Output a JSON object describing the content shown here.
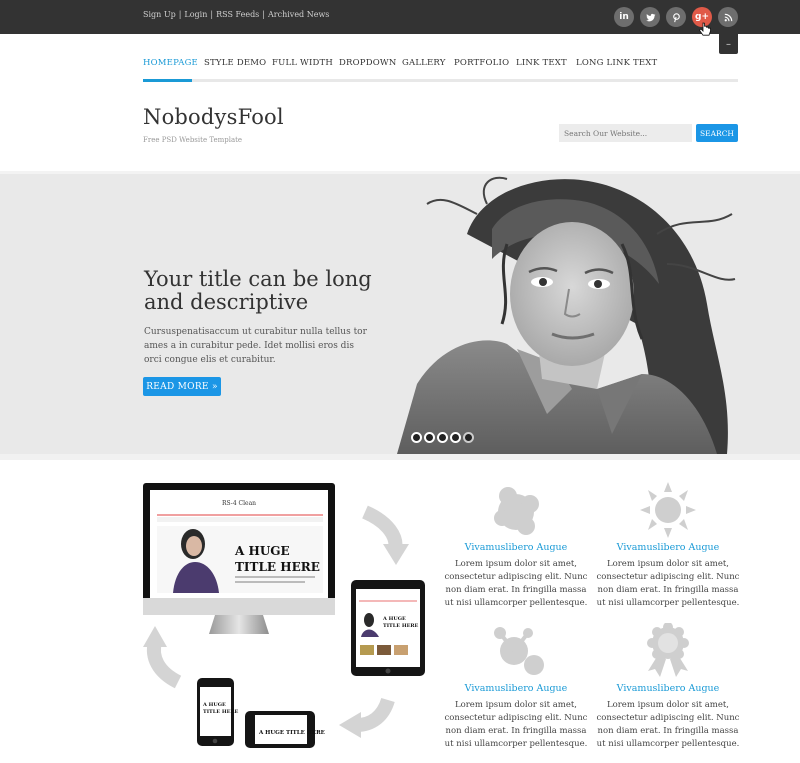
{
  "topbar": {
    "links": [
      "Sign Up",
      "Login",
      "RSS Feeds",
      "Archived News"
    ],
    "separator": "|",
    "social": [
      {
        "icon": "linkedin-icon",
        "glyph": "in"
      },
      {
        "icon": "twitter-icon",
        "glyph": "t"
      },
      {
        "icon": "pinterest-icon",
        "glyph": "p"
      },
      {
        "icon": "google-plus-icon",
        "glyph": "g+"
      },
      {
        "icon": "rss-icon",
        "glyph": "rss"
      }
    ],
    "toggle_label": "–"
  },
  "nav": {
    "items": [
      "HOMEPAGE",
      "STYLE DEMO",
      "FULL WIDTH",
      "DROPDOWN",
      "GALLERY",
      "PORTFOLIO",
      "LINK TEXT",
      "LONG LINK TEXT"
    ],
    "active_index": 0
  },
  "header": {
    "site_name": "NobodysFool",
    "tagline": "Free PSD Website Template",
    "search_placeholder": "Search Our Website...",
    "search_button": "SEARCH"
  },
  "slider": {
    "title": "Your title can be long and descriptive",
    "text": "Cursuspenatisaccum ut curabitur nulla tellus tor ames a in curabitur pede. Idet mollisi eros dis orci congue elis et curabitur.",
    "button": "READ MORE »",
    "dots_total": 5,
    "active_dot": 4
  },
  "devices_mockup": {
    "screen_brand": "RS-4 Clean",
    "screen_headline": "A HUGE TITLE HERE"
  },
  "features": [
    {
      "icon": "puzzle-blob-icon",
      "title": "Vivamuslibero Augue",
      "text": "Lorem ipsum dolor sit amet, consectetur adipiscing elit. Nunc non diam erat. In fringilla massa ut nisi ullamcorper pellentesque."
    },
    {
      "icon": "sun-icon",
      "title": "Vivamuslibero Augue",
      "text": "Lorem ipsum dolor sit amet, consectetur adipiscing elit. Nunc non diam erat. In fringilla massa ut nisi ullamcorper pellentesque."
    },
    {
      "icon": "molecule-icon",
      "title": "Vivamuslibero Augue",
      "text": "Lorem ipsum dolor sit amet, consectetur adipiscing elit. Nunc non diam erat. In fringilla massa ut nisi ullamcorper pellentesque."
    },
    {
      "icon": "award-ribbon-icon",
      "title": "Vivamuslibero Augue",
      "text": "Lorem ipsum dolor sit amet, consectetur adipiscing elit. Nunc non diam erat. In fringilla massa ut nisi ullamcorper pellentesque."
    }
  ],
  "colors": {
    "accent": "#1b96e6",
    "topbar": "#333333",
    "social_active": "#e05a48"
  }
}
